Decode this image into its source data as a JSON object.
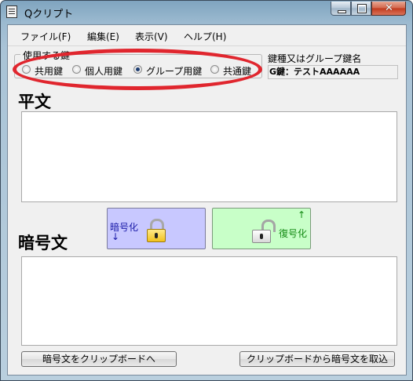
{
  "window": {
    "title": "Qクリプト",
    "minimize_symbol": "",
    "maximize_symbol": "",
    "close_symbol": "✕"
  },
  "menu": [
    {
      "label": "ファイル(F)"
    },
    {
      "label": "編集(E)"
    },
    {
      "label": "表示(V)"
    },
    {
      "label": "ヘルプ(H)"
    }
  ],
  "key_usage": {
    "legend": "使用する鍵",
    "options": [
      {
        "label": "共用鍵",
        "selected": false
      },
      {
        "label": "個人用鍵",
        "selected": false
      },
      {
        "label": "グループ用鍵",
        "selected": true
      },
      {
        "label": "共通鍵",
        "selected": false
      }
    ]
  },
  "key_name": {
    "label": "鍵種又はグループ鍵名",
    "value": "G鍵：テストAAAAAA"
  },
  "plaintext": {
    "title": "平文",
    "value": ""
  },
  "ciphertext": {
    "title": "暗号文",
    "value": ""
  },
  "encrypt_button": {
    "label": "暗号化",
    "arrow": "↓",
    "icon": "closed-lock-icon"
  },
  "decrypt_button": {
    "label": "復号化",
    "arrow": "↑",
    "icon": "open-lock-icon"
  },
  "scroll": {
    "up": "▲",
    "down": "▼"
  },
  "bottom_buttons": {
    "copy_to_clipboard": "暗号文をクリップボードへ",
    "paste_from_clipboard": "クリップボードから暗号文を取込"
  },
  "colors": {
    "annotation_circle": "#e0262e",
    "encrypt_bg": "#c8c8ff",
    "decrypt_bg": "#c8ffc8"
  }
}
